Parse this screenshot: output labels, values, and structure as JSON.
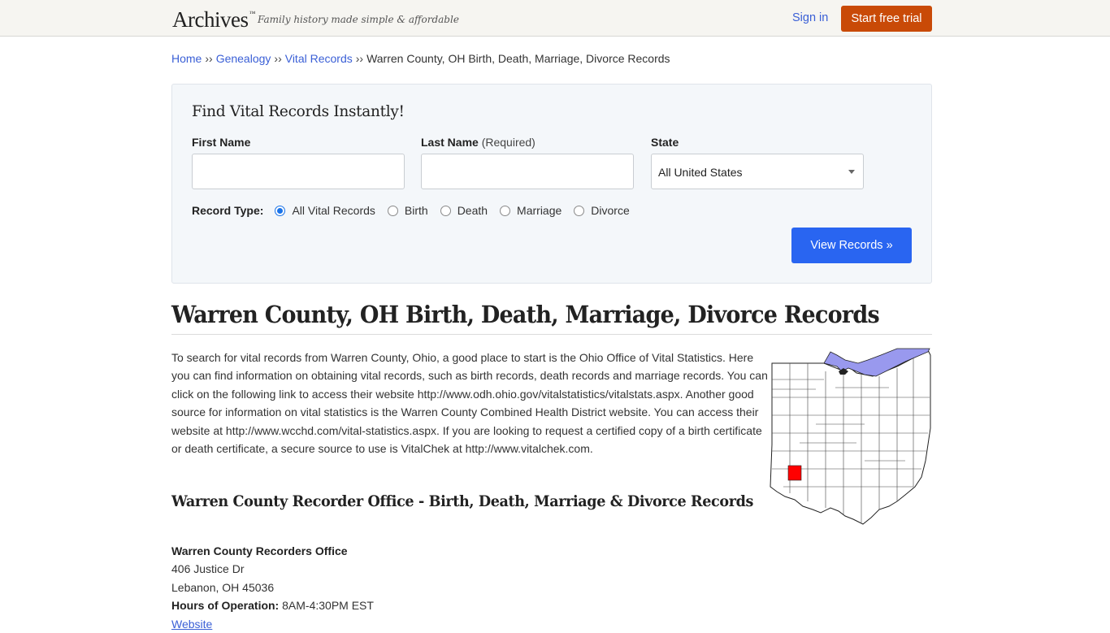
{
  "header": {
    "logo": "Archives",
    "logo_mark": "™",
    "tagline": "Family history made simple & affordable",
    "signin_label": "Sign in",
    "trial_label": "Start free trial",
    "colors": {
      "trial_bg": "#c94a07",
      "link": "#3a5fd6"
    }
  },
  "breadcrumb": {
    "items": [
      "Home",
      "Genealogy",
      "Vital Records"
    ],
    "separator": "››",
    "current": "Warren County, OH Birth, Death, Marriage, Divorce Records"
  },
  "search": {
    "title": "Find Vital Records Instantly!",
    "first_name_label": "First Name",
    "first_name_value": "",
    "last_name_label": "Last Name",
    "last_name_note": "(Required)",
    "last_name_value": "",
    "state_label": "State",
    "state_selected": "All United States",
    "record_type_label": "Record Type:",
    "record_types": [
      "All Vital Records",
      "Birth",
      "Death",
      "Marriage",
      "Divorce"
    ],
    "record_type_selected": "All Vital Records",
    "submit_label": "View Records »",
    "colors": {
      "submit_bg": "#2965f1",
      "card_bg": "#f4f7fa"
    }
  },
  "main": {
    "title": "Warren County, OH Birth, Death, Marriage, Divorce Records",
    "intro": "To search for vital records from Warren County, Ohio, a good place to start is the Ohio Office of Vital Statistics. Here you can find information on obtaining vital records, such as birth records, death records and marriage records. You can click on the following link to access their website http://www.odh.ohio.gov/vitalstatistics/vitalstats.aspx. Another good source for information on vital statistics is the Warren County Combined Health District website. You can access their website at http://www.wcchd.com/vital-statistics.aspx. If you are looking to request a certified copy of a birth certificate or death certificate, a secure source to use is VitalChek at http://www.vitalchek.com.",
    "map": {
      "icon": "ohio-county-map",
      "highlighted_county": "Warren County",
      "colors": {
        "highlight": "#ff0000",
        "lake": "#9999ee"
      }
    },
    "section_title": "Warren County Recorder Office - Birth, Death, Marriage & Divorce Records",
    "office": {
      "name": "Warren County Recorders Office",
      "address1": "406 Justice Dr",
      "address2": "Lebanon, OH 45036",
      "hours_label": "Hours of Operation:",
      "hours_value": "8AM-4:30PM EST",
      "website_label": "Website"
    }
  }
}
